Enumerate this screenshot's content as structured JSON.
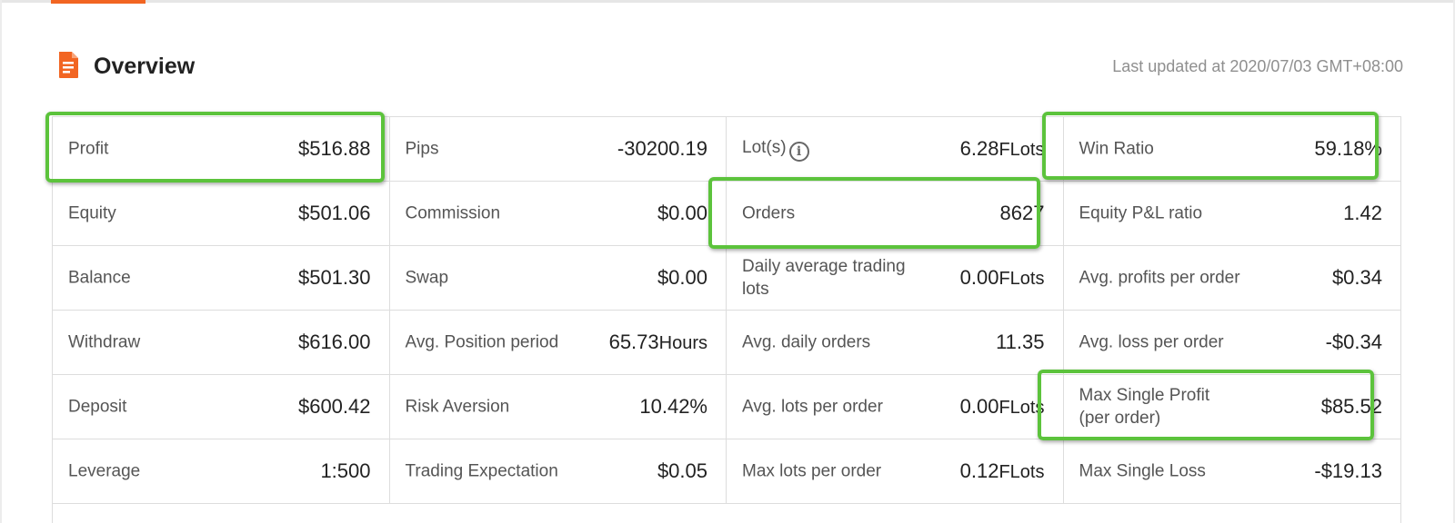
{
  "header": {
    "title": "Overview",
    "last_updated": "Last updated at 2020/07/03 GMT+08:00"
  },
  "accent_color": "#f26522",
  "highlight_color": "#5cc33c",
  "rows": [
    [
      {
        "label": "Profit",
        "value": "$516.88",
        "unit": "",
        "info_icon": false
      },
      {
        "label": "Pips",
        "value": "-30200.19",
        "unit": "",
        "info_icon": false
      },
      {
        "label": "Lot(s)",
        "value": "6.28",
        "unit": "FLots",
        "info_icon": true
      },
      {
        "label": "Win Ratio",
        "value": "59.18%",
        "unit": "",
        "info_icon": false
      }
    ],
    [
      {
        "label": "Equity",
        "value": "$501.06",
        "unit": "",
        "info_icon": false
      },
      {
        "label": "Commission",
        "value": "$0.00",
        "unit": "",
        "info_icon": false
      },
      {
        "label": "Orders",
        "value": "8627",
        "unit": "",
        "info_icon": false
      },
      {
        "label": "Equity P&L ratio",
        "value": "1.42",
        "unit": "",
        "info_icon": false
      }
    ],
    [
      {
        "label": "Balance",
        "value": "$501.30",
        "unit": "",
        "info_icon": false
      },
      {
        "label": "Swap",
        "value": "$0.00",
        "unit": "",
        "info_icon": false
      },
      {
        "label": "Daily average trading lots",
        "value": "0.00",
        "unit": "FLots",
        "info_icon": false
      },
      {
        "label": "Avg. profits per order",
        "value": "$0.34",
        "unit": "",
        "info_icon": false
      }
    ],
    [
      {
        "label": "Withdraw",
        "value": "$616.00",
        "unit": "",
        "info_icon": false
      },
      {
        "label": "Avg. Position period",
        "value": "65.73",
        "unit": "Hours",
        "info_icon": false
      },
      {
        "label": "Avg. daily orders",
        "value": "11.35",
        "unit": "",
        "info_icon": false
      },
      {
        "label": "Avg. loss per order",
        "value": "-$0.34",
        "unit": "",
        "info_icon": false
      }
    ],
    [
      {
        "label": "Deposit",
        "value": "$600.42",
        "unit": "",
        "info_icon": false
      },
      {
        "label": "Risk Aversion",
        "value": "10.42%",
        "unit": "",
        "info_icon": false
      },
      {
        "label": "Avg. lots per order",
        "value": "0.00",
        "unit": "FLots",
        "info_icon": false
      },
      {
        "label": "Max Single Profit (per order)",
        "value": "$85.52",
        "unit": "",
        "info_icon": false
      }
    ],
    [
      {
        "label": "Leverage",
        "value": "1:500",
        "unit": "",
        "info_icon": false
      },
      {
        "label": "Trading Expectation",
        "value": "$0.05",
        "unit": "",
        "info_icon": false
      },
      {
        "label": "Max lots per order",
        "value": "0.12",
        "unit": "FLots",
        "info_icon": false
      },
      {
        "label": "Max Single Loss",
        "value": "-$19.13",
        "unit": "",
        "info_icon": false
      }
    ]
  ],
  "highlighted_cells": [
    "Profit",
    "Win Ratio",
    "Orders",
    "Max Single Profit (per order)"
  ]
}
